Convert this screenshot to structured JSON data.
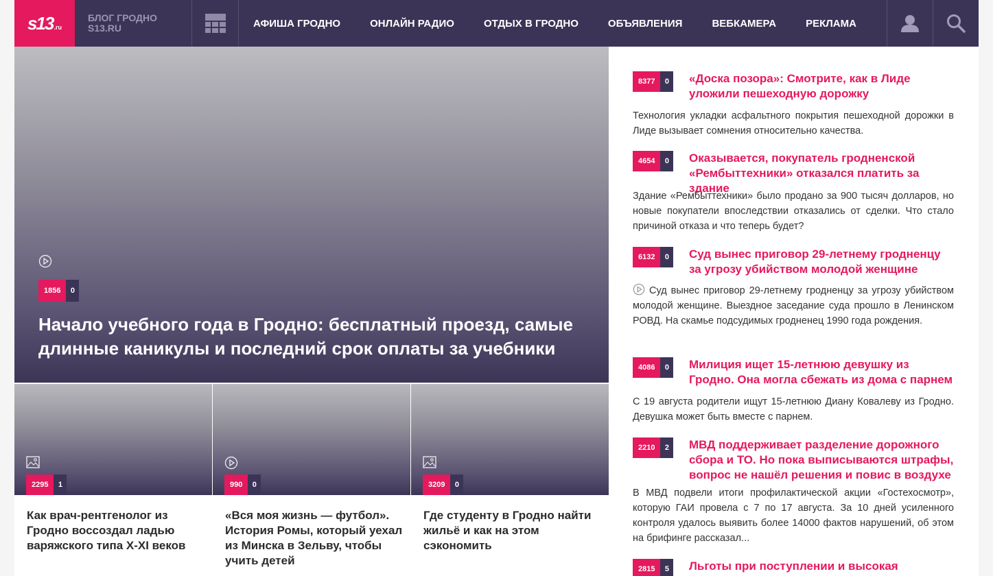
{
  "header": {
    "logo_text": "s13",
    "logo_suffix": ".ru",
    "blog_title_line1": "БЛОГ ГРОДНО",
    "blog_title_line2": "S13.RU",
    "nav": [
      "АФИША ГРОДНО",
      "ОНЛАЙН РАДИО",
      "ОТДЫХ В ГРОДНО",
      "ОБЪЯВЛЕНИЯ",
      "ВЕБКАМЕРА",
      "РЕКЛАМА"
    ]
  },
  "hero": {
    "views": "1856",
    "comments": "0",
    "title": "Начало учебного года в Гродно: бесплатный проезд, самые длинные каникулы и последний срок оплаты за учебники"
  },
  "cards": [
    {
      "icon": "image-icon",
      "views": "2295",
      "comments": "1",
      "title": "Как врач-рентгенолог из Гродно воссоздал ладью варяжского типа X-XI веков"
    },
    {
      "icon": "play-icon",
      "views": "990",
      "comments": "0",
      "title": "«Вся моя жизнь — футбол». История Ромы, который уехал из Минска в Зельву, чтобы учить детей"
    },
    {
      "icon": "image-icon",
      "views": "3209",
      "comments": "0",
      "title": "Где студенту в Гродно найти жильё и как на этом сэкономить"
    }
  ],
  "news": [
    {
      "views": "8377",
      "comments": "0",
      "title": "«Доска позора»: Смотрите, как в Лиде уложили пешеходную дорожку",
      "text": "Технология укладки асфальтного покрытия пешеходной дорожки в Лиде вызывает сомнения относительно качества."
    },
    {
      "views": "4654",
      "comments": "0",
      "title": "Оказывается, покупатель гродненской «Рембыттехники» отказался платить за здание",
      "text": "Здание «Рембыттехники» было продано за 900 тысяч долларов, но новые покупатели впоследствии отказались от сделки. Что стало причиной отказа и что теперь будет?"
    },
    {
      "views": "6132",
      "comments": "0",
      "title": "Суд вынес приговор 29-летнему гродненцу за угрозу убийством молодой женщине",
      "text": "Суд вынес приговор 29-летнему гродненцу за угрозу убийством молодой женщине. Выездное заседание суда прошло в Ленинском РОВД. На скамье подсудимых гродненец 1990 года рождения."
    },
    {
      "views": "4086",
      "comments": "0",
      "title": "Милиция ищет 15-летнюю девушку из Гродно. Она могла сбежать из дома с парнем",
      "text": "С 19 августа родители ищут 15-летнюю Диану Ковалеву из Гродно. Девушка может быть вместе с парнем."
    },
    {
      "views": "2210",
      "comments": "2",
      "title": "МВД поддерживает разделение дорожного сбора и ТО. Но пока выписываются штрафы, вопрос не нашёл решения и повис в воздухе",
      "text": "В МВД подвели итоги профилактической акции «Гостехосмотр», которую ГАИ провела с 7 по 17 августа. За 10 дней усиленного контроля удалось выявить более 14000 фактов нарушений, об этом на брифинге рассказал..."
    },
    {
      "views": "2815",
      "comments": "5",
      "title": "Льготы при поступлении и высокая стипендия.",
      "text": ""
    }
  ]
}
